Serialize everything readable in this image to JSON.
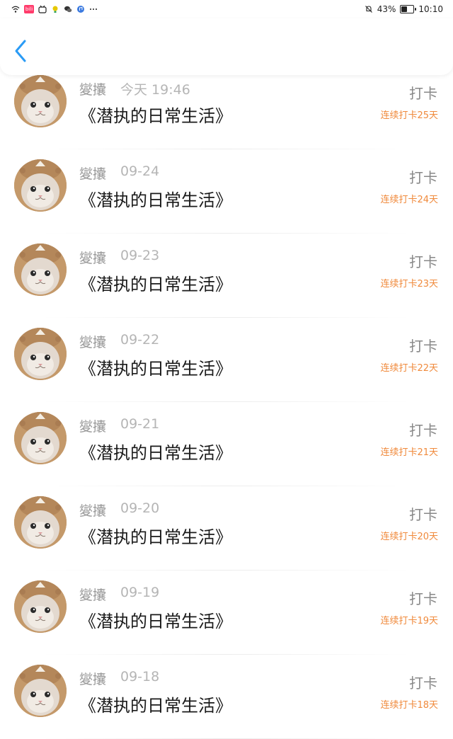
{
  "status_bar": {
    "battery": "43%",
    "time": "10:10",
    "battery_level": 0.43,
    "app_badge": "bili"
  },
  "header": {
    "back_icon": "chevron-left-icon",
    "accent": "#2a9bf5"
  },
  "items": [
    {
      "name": "夑攮",
      "date": "今天 19:46",
      "title": "《潜执的日常生活》",
      "action": "打卡",
      "streak": "连续打卡25天"
    },
    {
      "name": "夑攮",
      "date": "09-24",
      "title": "《潜执的日常生活》",
      "action": "打卡",
      "streak": "连续打卡24天"
    },
    {
      "name": "夑攮",
      "date": "09-23",
      "title": "《潜执的日常生活》",
      "action": "打卡",
      "streak": "连续打卡23天"
    },
    {
      "name": "夑攮",
      "date": "09-22",
      "title": "《潜执的日常生活》",
      "action": "打卡",
      "streak": "连续打卡22天"
    },
    {
      "name": "夑攮",
      "date": "09-21",
      "title": "《潜执的日常生活》",
      "action": "打卡",
      "streak": "连续打卡21天"
    },
    {
      "name": "夑攮",
      "date": "09-20",
      "title": "《潜执的日常生活》",
      "action": "打卡",
      "streak": "连续打卡20天"
    },
    {
      "name": "夑攮",
      "date": "09-19",
      "title": "《潜执的日常生活》",
      "action": "打卡",
      "streak": "连续打卡19天"
    },
    {
      "name": "夑攮",
      "date": "09-18",
      "title": "《潜执的日常生活》",
      "action": "打卡",
      "streak": "连续打卡18天"
    }
  ]
}
